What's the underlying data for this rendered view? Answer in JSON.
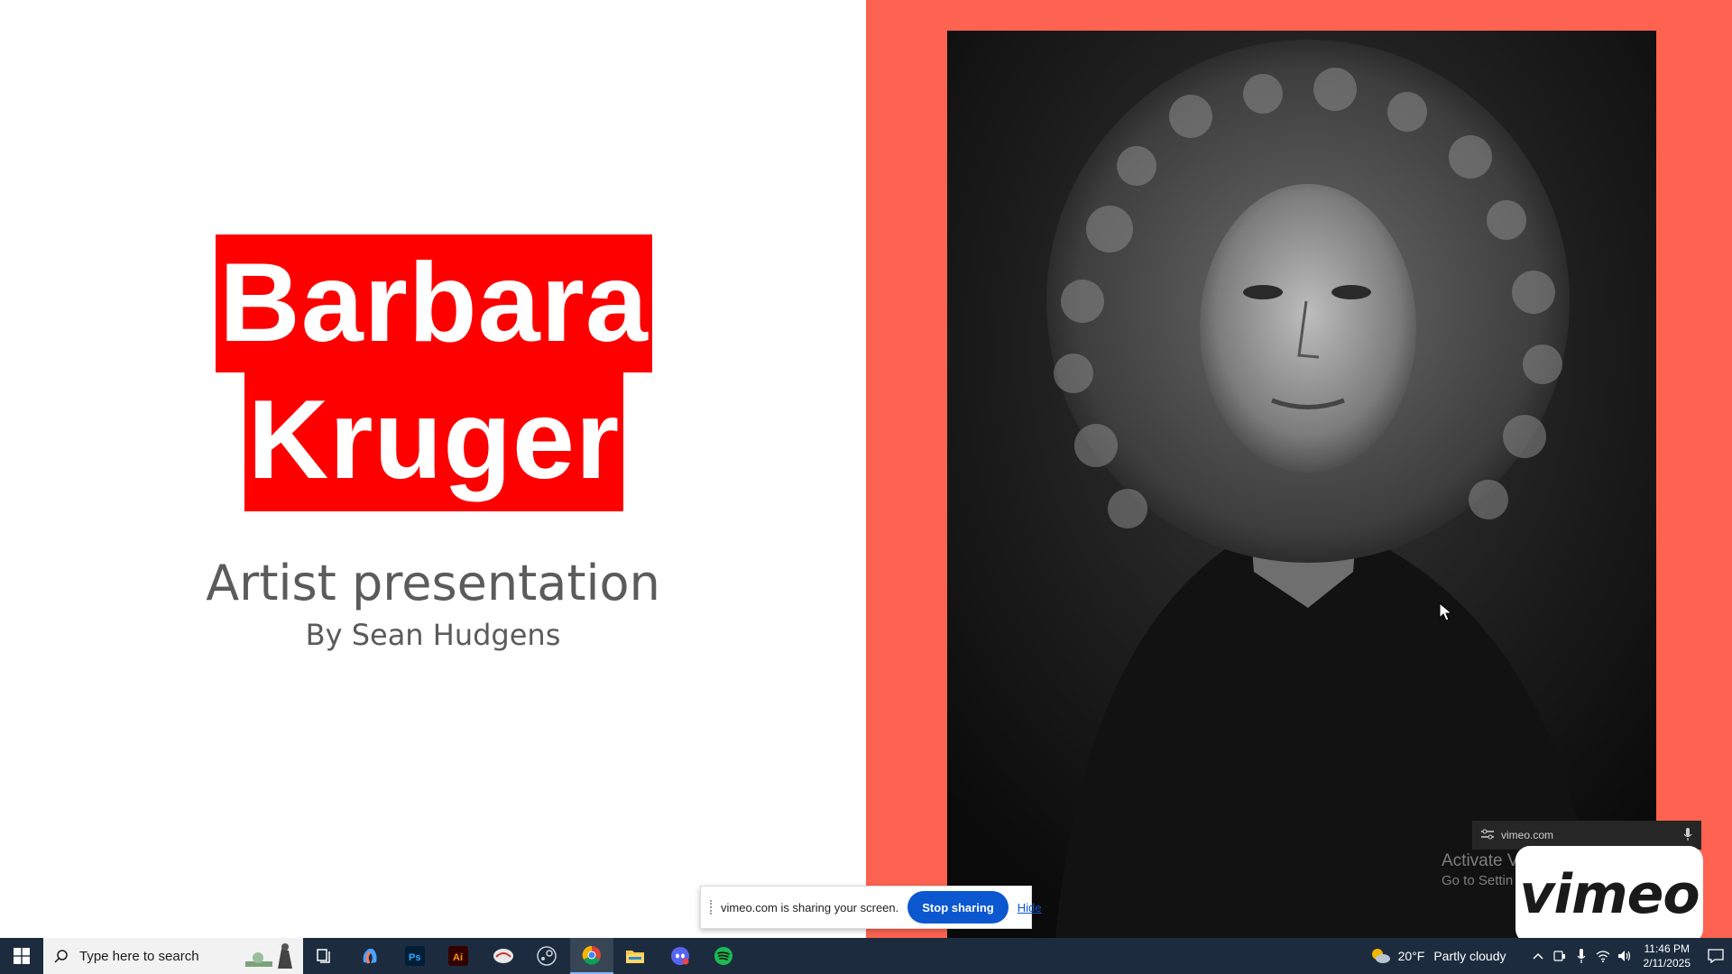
{
  "slide": {
    "title_line1": "Barbara",
    "title_line2": "Kruger",
    "subtitle": "Artist presentation",
    "byline": "By Sean Hudgens",
    "colors": {
      "accent_red": "#ff0000",
      "right_panel": "#fd6350"
    },
    "photo": "black-and-white portrait photograph"
  },
  "share_bar": {
    "message": "vimeo.com is sharing your screen.",
    "stop_label": "Stop sharing",
    "hide_label": "Hide"
  },
  "vimeo_popup": {
    "url": "vimeo.com",
    "logo_text": "vimeo"
  },
  "watermark": {
    "line1": "Activate V",
    "line2": "Go to Settin"
  },
  "taskbar": {
    "search_placeholder": "Type here to search",
    "pinned_apps": [
      "task-view-icon",
      "copilot-icon",
      "photoshop-icon",
      "illustrator-icon",
      "game-icon",
      "steam-icon",
      "chrome-icon",
      "file-explorer-icon",
      "discord-icon",
      "spotify-icon"
    ],
    "weather": {
      "temperature": "20°F",
      "condition": "Partly cloudy"
    },
    "clock": {
      "time": "11:46 PM",
      "date": "2/11/2025"
    }
  }
}
